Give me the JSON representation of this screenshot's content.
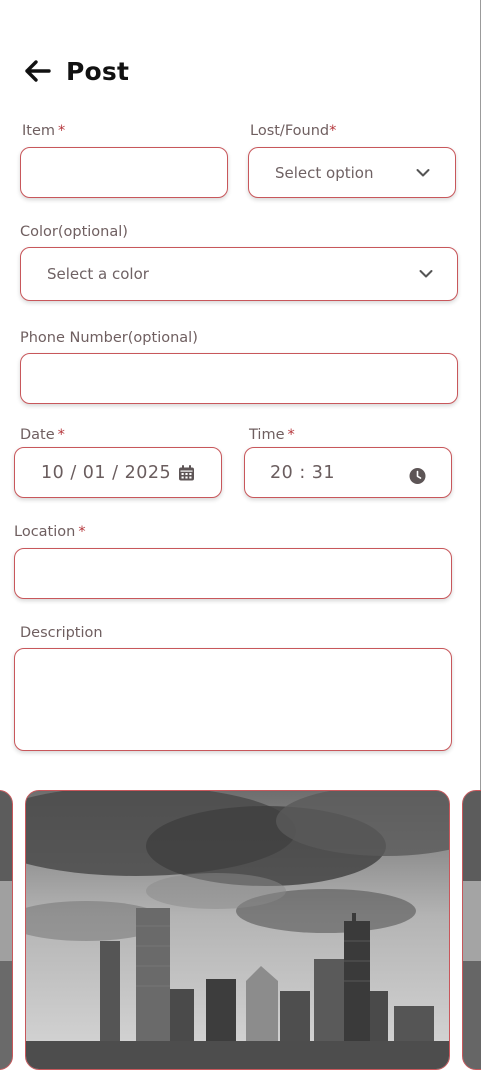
{
  "header": {
    "title": "Post",
    "back_icon": "arrow-left-icon"
  },
  "form": {
    "item": {
      "label": "Item",
      "required": "*",
      "value": ""
    },
    "lost_found": {
      "label": "Lost/Found",
      "required": "*",
      "selected": "Select option"
    },
    "color": {
      "label": "Color(optional)",
      "selected": "Select a color"
    },
    "phone": {
      "label": "Phone Number(optional)",
      "value": ""
    },
    "date": {
      "label": "Date",
      "required": "*",
      "value": "10 / 01 / 2025",
      "icon": "calendar-icon"
    },
    "time": {
      "label": "Time",
      "required": "*",
      "value": "20 : 31",
      "icon": "clock-icon"
    },
    "location": {
      "label": "Location",
      "required": "*",
      "value": ""
    },
    "description": {
      "label": "Description",
      "value": ""
    }
  },
  "carousel": {
    "current_image": "city skyline photo",
    "icon": "chevron-down-icon"
  },
  "colors": {
    "accent": "#c8575b",
    "required": "#b5373c",
    "label": "#6f5f60",
    "title": "#111111"
  }
}
